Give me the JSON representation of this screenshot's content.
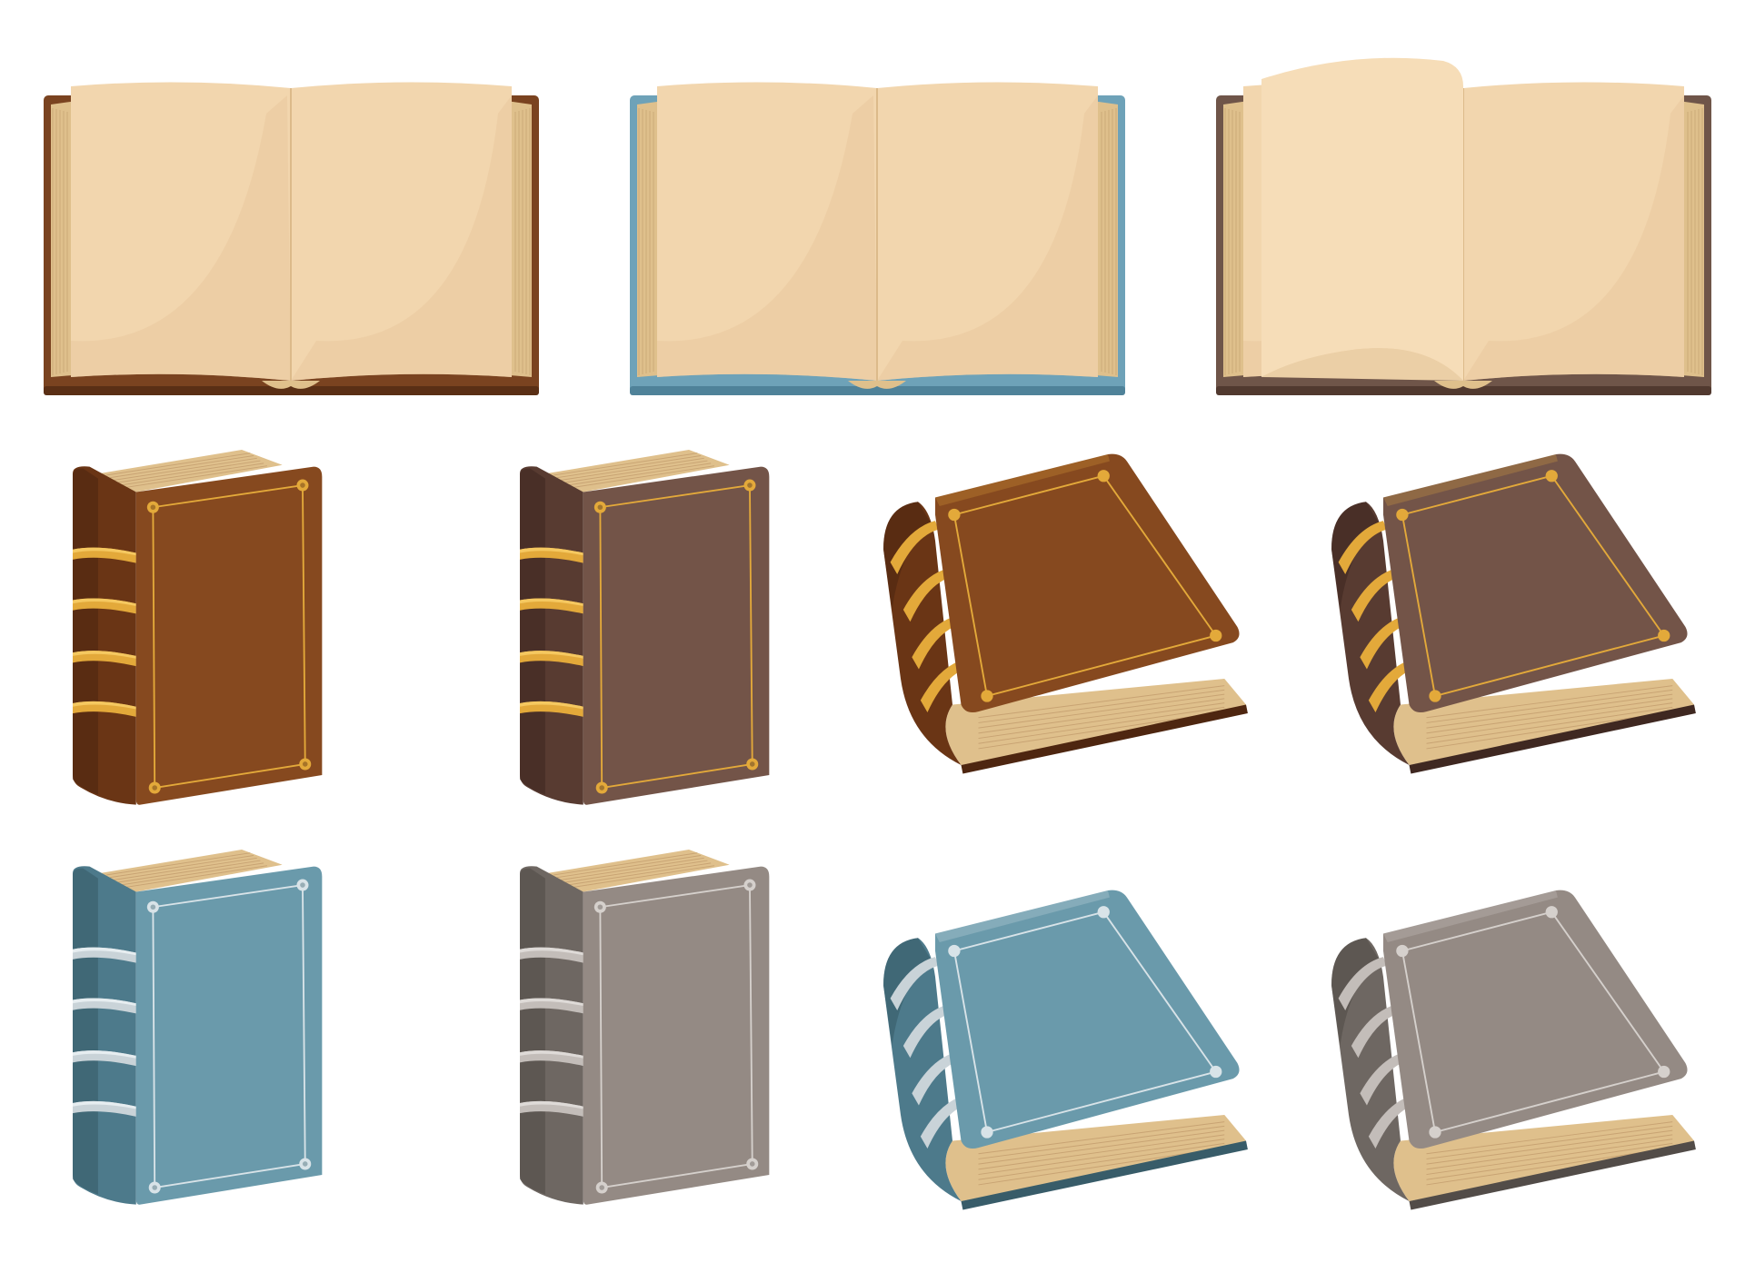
{
  "illustration": {
    "open_books": [
      {
        "variant": "open-book-brown",
        "cover": "#7a4320",
        "cover_dark": "#5a2f15",
        "turning_page": false
      },
      {
        "variant": "open-book-blue",
        "cover": "#6ea2b8",
        "cover_dark": "#4f8299",
        "turning_page": false
      },
      {
        "variant": "open-book-taupe",
        "cover": "#6f5549",
        "cover_dark": "#51392f",
        "turning_page": true
      }
    ],
    "standing_books": [
      {
        "variant": "standing-book-brown",
        "cover": "#86491f",
        "spine": "#6a3515",
        "spine_dark": "#4e2610",
        "band": "#e3a93a",
        "band_light": "#f5c860",
        "trim": "#e3a93a"
      },
      {
        "variant": "standing-book-taupe",
        "cover": "#735448",
        "spine": "#583b31",
        "spine_dark": "#3f2821",
        "band": "#e3a93a",
        "band_light": "#f5c860",
        "trim": "#e3a93a"
      },
      {
        "variant": "standing-book-blue",
        "cover": "#6a9aab",
        "spine": "#4d7a8b",
        "spine_dark": "#385c69",
        "band": "#c9d3d8",
        "band_light": "#e6edf0",
        "trim": "#d8e3e8"
      },
      {
        "variant": "standing-book-gray",
        "cover": "#948a84",
        "spine": "#6e6762",
        "spine_dark": "#524c48",
        "band": "#c3bdb9",
        "band_light": "#dedad7",
        "trim": "#d5d0cc"
      }
    ],
    "lying_books": [
      {
        "variant": "lying-book-brown",
        "cover": "#86491f",
        "spine": "#6a3515",
        "spine_dark": "#4e2610",
        "band": "#e3a93a",
        "trim": "#e3a93a"
      },
      {
        "variant": "lying-book-taupe",
        "cover": "#735448",
        "spine": "#583b31",
        "spine_dark": "#3f2821",
        "band": "#e3a93a",
        "trim": "#e3a93a"
      },
      {
        "variant": "lying-book-blue",
        "cover": "#6a9aab",
        "spine": "#4d7a8b",
        "spine_dark": "#385c69",
        "band": "#c9d3d8",
        "trim": "#d8e3e8"
      },
      {
        "variant": "lying-book-gray",
        "cover": "#948a84",
        "spine": "#6e6762",
        "spine_dark": "#524c48",
        "band": "#c3bdb9",
        "trim": "#d5d0cc"
      }
    ],
    "page_color": "#f2d6ae",
    "page_shade": "#e9c99e",
    "page_edge": "#dfc08c"
  }
}
